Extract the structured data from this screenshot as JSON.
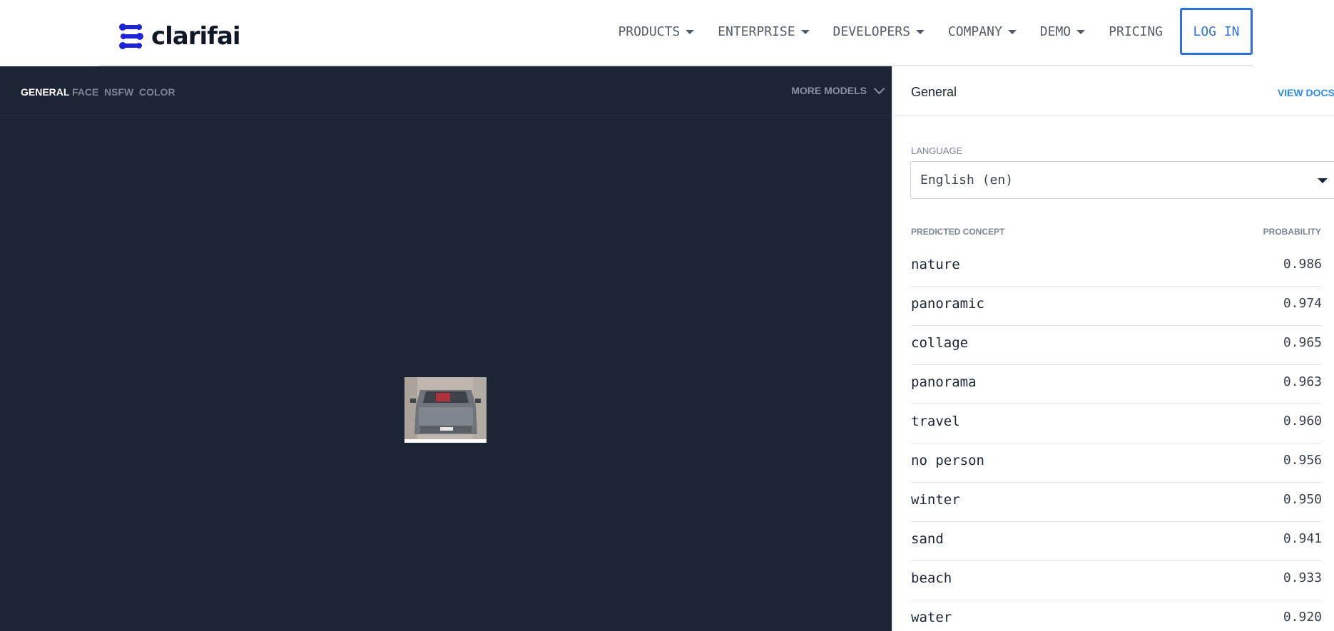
{
  "header": {
    "logo_text": "clarifai",
    "nav": [
      {
        "label": "PRODUCTS",
        "has_dropdown": true
      },
      {
        "label": "ENTERPRISE",
        "has_dropdown": true
      },
      {
        "label": "DEVELOPERS",
        "has_dropdown": true
      },
      {
        "label": "COMPANY",
        "has_dropdown": true
      },
      {
        "label": "DEMO",
        "has_dropdown": true
      },
      {
        "label": "PRICING",
        "has_dropdown": false
      }
    ],
    "login_label": "LOG IN"
  },
  "viewer": {
    "tabs": [
      "GENERAL",
      "FACE",
      "NSFW",
      "COLOR"
    ],
    "active_tab": "GENERAL",
    "more_models_label": "MORE MODELS"
  },
  "panel": {
    "title": "General",
    "view_docs_label": "VIEW DOCS",
    "language_label": "LANGUAGE",
    "language_value": "English (en)",
    "concept_header": "PREDICTED CONCEPT",
    "probability_header": "PROBABILITY",
    "predictions": [
      {
        "concept": "nature",
        "probability": "0.986"
      },
      {
        "concept": "panoramic",
        "probability": "0.974"
      },
      {
        "concept": "collage",
        "probability": "0.965"
      },
      {
        "concept": "panorama",
        "probability": "0.963"
      },
      {
        "concept": "travel",
        "probability": "0.960"
      },
      {
        "concept": "no person",
        "probability": "0.956"
      },
      {
        "concept": "winter",
        "probability": "0.950"
      },
      {
        "concept": "sand",
        "probability": "0.941"
      },
      {
        "concept": "beach",
        "probability": "0.933"
      },
      {
        "concept": "water",
        "probability": "0.920"
      }
    ]
  },
  "colors": {
    "brand_blue": "#2f6fdc",
    "logo_blue": "#1f23d8",
    "dark_bg": "#1c2533",
    "link_blue": "#2d8cf0"
  }
}
